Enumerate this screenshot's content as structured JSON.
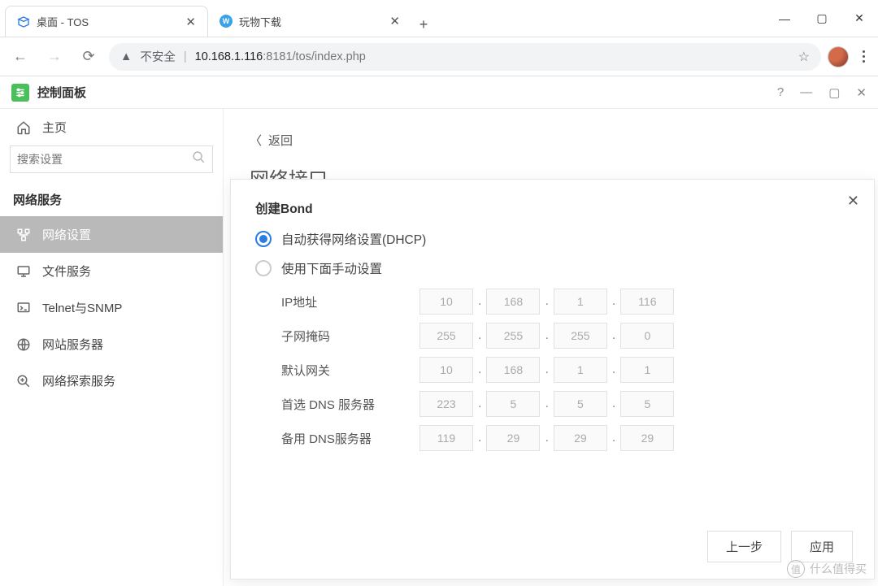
{
  "window": {
    "minimize": "—",
    "maximize": "▢",
    "close": "✕"
  },
  "tabs": [
    {
      "title": "桌面 - TOS",
      "active": true
    },
    {
      "title": "玩物下载",
      "active": false
    }
  ],
  "address": {
    "insecure_label": "不安全",
    "url_host": "10.168.1.116",
    "url_port": ":8181",
    "url_path": "/tos/index.php"
  },
  "appbar": {
    "title": "控制面板",
    "help": "?",
    "min": "—",
    "max": "▢",
    "close": "✕"
  },
  "sidebar": {
    "home": "主页",
    "search_placeholder": "搜索设置",
    "group": "网络服务",
    "items": [
      {
        "label": "网络设置"
      },
      {
        "label": "文件服务"
      },
      {
        "label": "Telnet与SNMP"
      },
      {
        "label": "网站服务器"
      },
      {
        "label": "网络探索服务"
      }
    ]
  },
  "page": {
    "back": "返回",
    "title": "网络接口"
  },
  "modal": {
    "title": "创建Bond",
    "option_dhcp": "自动获得网络设置(DHCP)",
    "option_manual": "使用下面手动设置",
    "fields": {
      "ip": {
        "label": "IP地址",
        "value": [
          "10",
          "168",
          "1",
          "116"
        ]
      },
      "mask": {
        "label": "子网掩码",
        "value": [
          "255",
          "255",
          "255",
          "0"
        ]
      },
      "gateway": {
        "label": "默认网关",
        "value": [
          "10",
          "168",
          "1",
          "1"
        ]
      },
      "dns1": {
        "label": "首选 DNS 服务器",
        "value": [
          "223",
          "5",
          "5",
          "5"
        ]
      },
      "dns2": {
        "label": "备用 DNS服务器",
        "value": [
          "119",
          "29",
          "29",
          "29"
        ]
      }
    },
    "prev": "上一步",
    "apply": "应用"
  },
  "watermark": "什么值得买"
}
